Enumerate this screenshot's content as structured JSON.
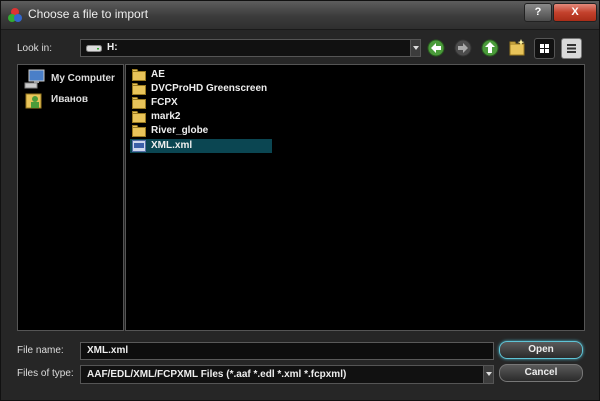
{
  "window": {
    "title": "Choose a file to import",
    "help_label": "?",
    "close_label": "X"
  },
  "lookin": {
    "label": "Look in:",
    "value": "H:"
  },
  "toolbar": [
    "back-icon",
    "forward-icon",
    "up-folder-icon",
    "new-folder-icon",
    "list-view-icon",
    "details-view-icon"
  ],
  "places": [
    {
      "label": "My Computer",
      "icon": "computer-icon"
    },
    {
      "label": "Иванов",
      "icon": "user-folder-icon"
    }
  ],
  "files": [
    {
      "name": "AE",
      "type": "folder"
    },
    {
      "name": "DVCProHD Greenscreen",
      "type": "folder"
    },
    {
      "name": "FCPX",
      "type": "folder"
    },
    {
      "name": "mark2",
      "type": "folder"
    },
    {
      "name": "River_globe",
      "type": "folder"
    },
    {
      "name": "XML.xml",
      "type": "file",
      "selected": true
    }
  ],
  "filename": {
    "label": "File name:",
    "value": "XML.xml"
  },
  "filetype": {
    "label": "Files of type:",
    "value": "AAF/EDL/XML/FCPXML Files (*.aaf *.edl *.xml *.fcpxml)"
  },
  "buttons": {
    "open": "Open",
    "cancel": "Cancel"
  },
  "colors": {
    "selection": "#0b4652",
    "accent": "#5fc4d6",
    "background": "#262626",
    "list_background": "#000000"
  }
}
